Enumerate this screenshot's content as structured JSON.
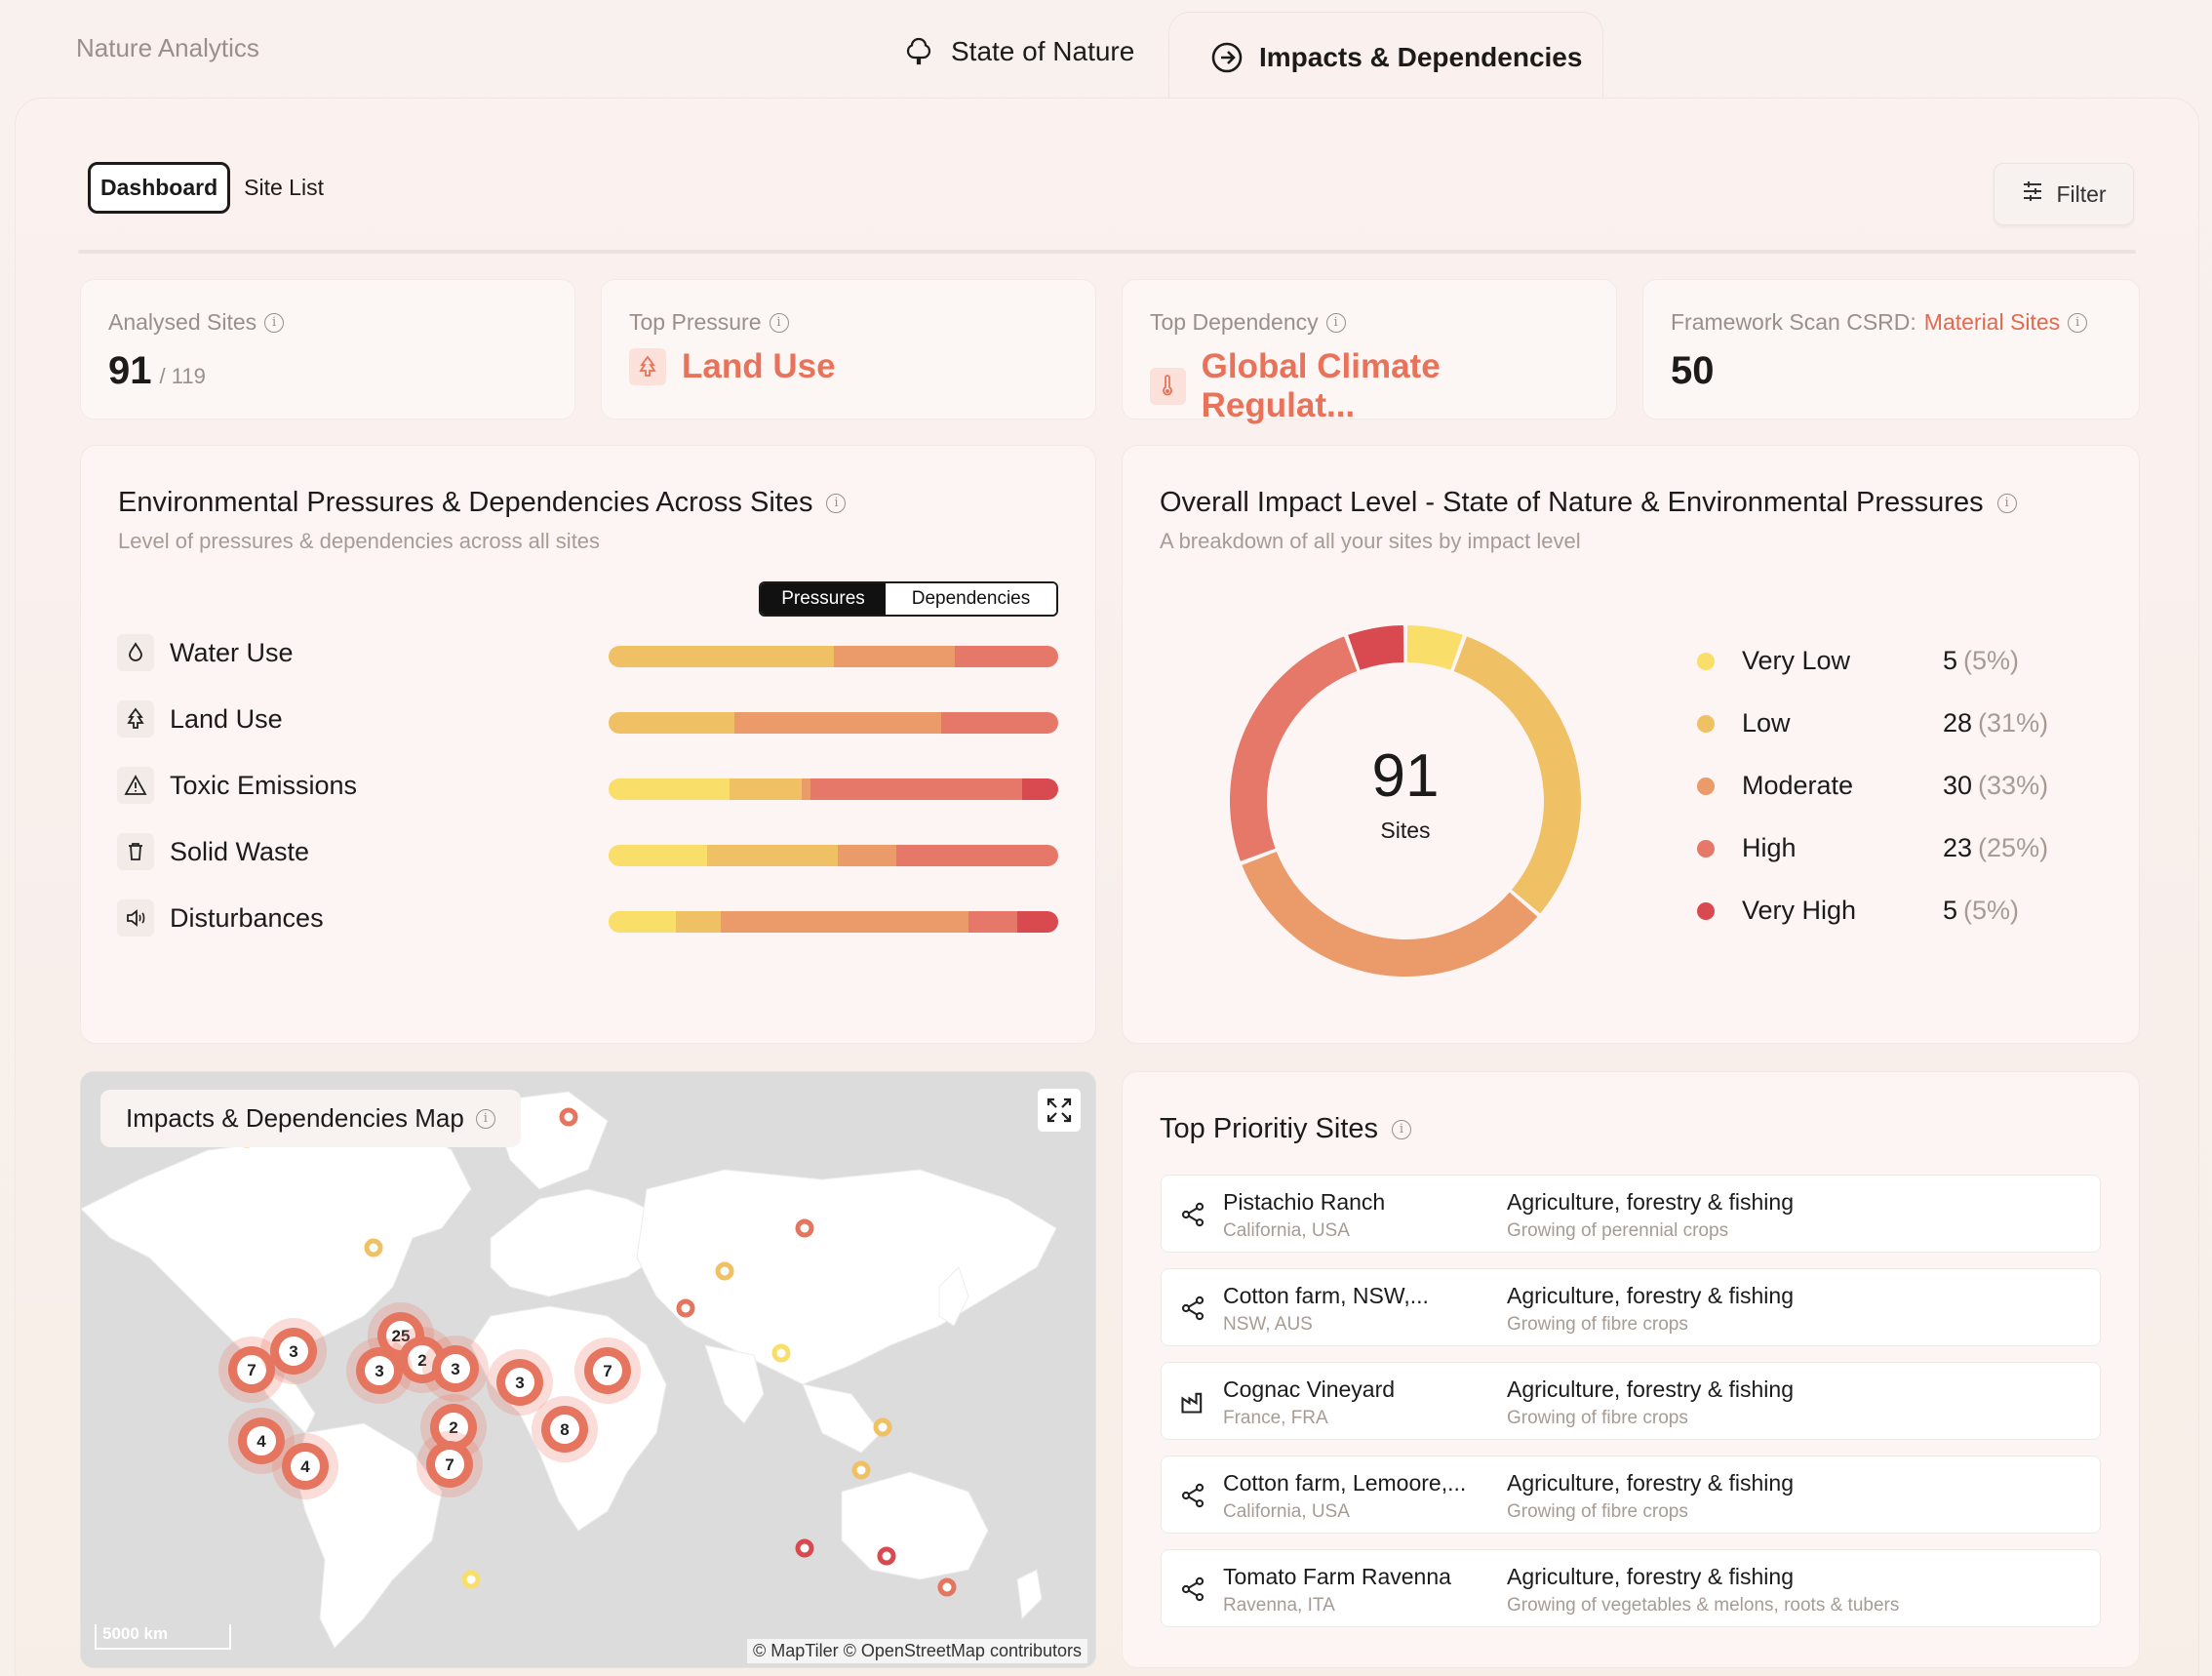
{
  "app": {
    "brand": "Nature Analytics"
  },
  "top_tabs": [
    {
      "label": "State of Nature",
      "icon": "tree-icon"
    },
    {
      "label": "Impacts & Dependencies",
      "icon": "arrow-circle-icon"
    }
  ],
  "subtabs": {
    "dashboard": "Dashboard",
    "site_list": "Site List"
  },
  "filter": {
    "label": "Filter",
    "icon": "sliders-icon"
  },
  "kpis": {
    "analysed": {
      "label": "Analysed Sites",
      "value": "91",
      "sub": "/ 119"
    },
    "top_pressure": {
      "label": "Top Pressure",
      "value": "Land Use"
    },
    "top_dependency": {
      "label": "Top Dependency",
      "value": "Global Climate Regulat..."
    },
    "framework": {
      "label": "Framework Scan CSRD:",
      "label_accent": "Material Sites",
      "value": "50"
    }
  },
  "pressures_card": {
    "title": "Environmental Pressures & Dependencies Across Sites",
    "subtitle": "Level of pressures & dependencies across all sites",
    "toggle": {
      "on": "Pressures",
      "off": "Dependencies"
    },
    "rows": [
      {
        "label": "Water Use",
        "icon": "droplet-icon",
        "segments": [
          0,
          50,
          27,
          23,
          0
        ]
      },
      {
        "label": "Land Use",
        "icon": "tree-icon",
        "segments": [
          0,
          28,
          46,
          26,
          0
        ]
      },
      {
        "label": "Toxic Emissions",
        "icon": "warning-icon",
        "segments": [
          27,
          16,
          2,
          47,
          8
        ]
      },
      {
        "label": "Solid Waste",
        "icon": "trash-icon",
        "segments": [
          22,
          29,
          13,
          36,
          0
        ]
      },
      {
        "label": "Disturbances",
        "icon": "speaker-icon",
        "segments": [
          15,
          10,
          55,
          11,
          9
        ]
      }
    ]
  },
  "impact_card": {
    "title": "Overall Impact Level - State of Nature & Environmental Pressures",
    "subtitle": "A breakdown of all your sites by impact level",
    "center_value": "91",
    "center_label": "Sites",
    "legend": [
      {
        "label": "Very Low",
        "value": "5",
        "pct": "(5%)",
        "count": 5,
        "color": "#f9df6a"
      },
      {
        "label": "Low",
        "value": "28",
        "pct": "(31%)",
        "count": 28,
        "color": "#f0c064"
      },
      {
        "label": "Moderate",
        "value": "30",
        "pct": "(33%)",
        "count": 30,
        "color": "#eb9a6a"
      },
      {
        "label": "High",
        "value": "23",
        "pct": "(25%)",
        "count": 23,
        "color": "#e6786a"
      },
      {
        "label": "Very High",
        "value": "5",
        "pct": "(5%)",
        "count": 5,
        "color": "#d84a4f"
      }
    ]
  },
  "map": {
    "title": "Impacts & Dependencies Map",
    "scale": "5000 km",
    "attribution": "© MapTiler © OpenStreetMap contributors",
    "clusters": [
      "7",
      "3",
      "25",
      "2",
      "3",
      "3",
      "3",
      "7",
      "2",
      "8",
      "7",
      "4",
      "4"
    ]
  },
  "priority": {
    "title": "Top Prioritiy Sites",
    "sites": [
      {
        "name": "Pistachio Ranch",
        "location": "California, USA",
        "sector": "Agriculture, forestry & fishing",
        "activity": "Growing of perennial crops",
        "icon": "share-icon"
      },
      {
        "name": "Cotton farm, NSW,...",
        "location": "NSW, AUS",
        "sector": "Agriculture, forestry & fishing",
        "activity": "Growing of fibre crops",
        "icon": "share-icon"
      },
      {
        "name": "Cognac Vineyard",
        "location": "France, FRA",
        "sector": "Agriculture, forestry & fishing",
        "activity": "Growing of fibre crops",
        "icon": "factory-icon"
      },
      {
        "name": "Cotton farm, Lemoore,...",
        "location": "California, USA",
        "sector": "Agriculture, forestry & fishing",
        "activity": "Growing of fibre crops",
        "icon": "share-icon"
      },
      {
        "name": "Tomato Farm Ravenna",
        "location": "Ravenna, ITA",
        "sector": "Agriculture, forestry & fishing",
        "activity": "Growing of vegetables & melons, roots & tubers",
        "icon": "share-icon"
      }
    ]
  },
  "colors": {
    "very_low": "#f9df6a",
    "low": "#f0c064",
    "moderate": "#eb9a6a",
    "high": "#e6786a",
    "very_high": "#d84a4f",
    "accent": "#e8735a"
  }
}
